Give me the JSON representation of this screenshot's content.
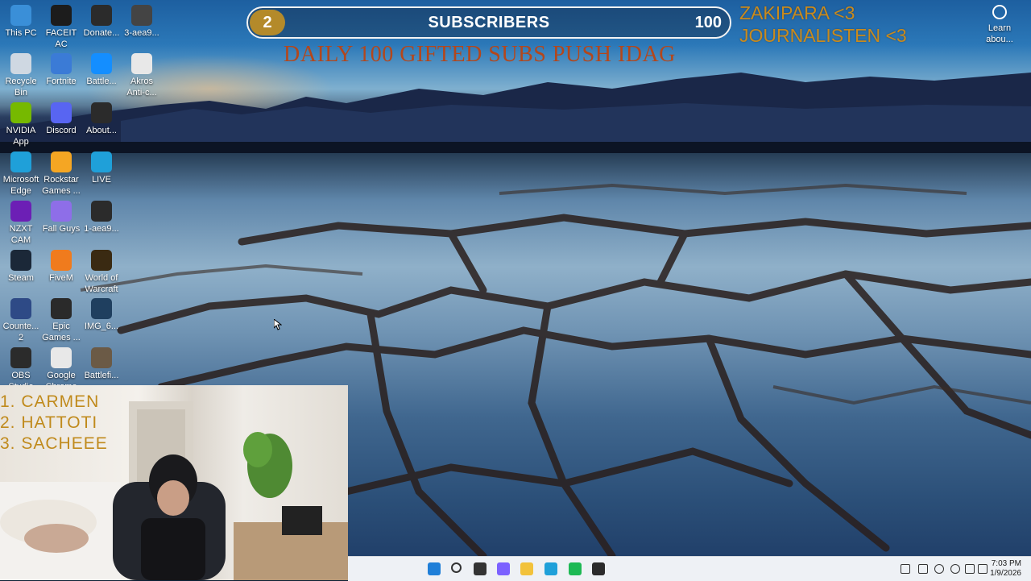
{
  "desktop_icons": [
    {
      "label": "This PC",
      "icon": "monitor-icon",
      "color": "#3a8fd8"
    },
    {
      "label": "FACEIT AC",
      "icon": "faceit-icon",
      "color": "#1c1c1c"
    },
    {
      "label": "Donate...",
      "icon": "donate-icon",
      "color": "#2b2b2b"
    },
    {
      "label": "3-aea9...",
      "icon": "image-file-icon",
      "color": "#444444"
    },
    {
      "label": "Recycle Bin",
      "icon": "recycle-bin-icon",
      "color": "#cfd8e2"
    },
    {
      "label": "Fortnite",
      "icon": "fortnite-icon",
      "color": "#3b7bd6"
    },
    {
      "label": "Battle...",
      "icon": "battlenet-icon",
      "color": "#148eff"
    },
    {
      "label": "Akros Anti-c...",
      "icon": "akros-icon",
      "color": "#e8e8e8"
    },
    {
      "label": "NVIDIA App",
      "icon": "nvidia-icon",
      "color": "#76b900"
    },
    {
      "label": "Discord",
      "icon": "discord-icon",
      "color": "#5865f2"
    },
    {
      "label": "About...",
      "icon": "about-file-icon",
      "color": "#2b2b2b"
    },
    {
      "label": "Microsoft Edge",
      "icon": "edge-icon",
      "color": "#1fa0d9"
    },
    {
      "label": "Rockstar Games ...",
      "icon": "rockstar-icon",
      "color": "#f5a623"
    },
    {
      "label": "LIVE",
      "icon": "live-icon",
      "color": "#1fa0d9"
    },
    {
      "label": "NZXT CAM",
      "icon": "nzxt-icon",
      "color": "#6c1fb5"
    },
    {
      "label": "Fall Guys",
      "icon": "fallguys-icon",
      "color": "#8e6ee8"
    },
    {
      "label": "1-aea9...",
      "icon": "image-file-icon",
      "color": "#2b2b2b"
    },
    {
      "label": "Steam",
      "icon": "steam-icon",
      "color": "#1b2838"
    },
    {
      "label": "FiveM",
      "icon": "fivem-icon",
      "color": "#f07b1d"
    },
    {
      "label": "World of Warcraft",
      "icon": "wow-icon",
      "color": "#3a2a12"
    },
    {
      "label": "Counte... 2",
      "icon": "cs2-icon",
      "color": "#2e4a86"
    },
    {
      "label": "Epic Games ...",
      "icon": "epic-games-icon",
      "color": "#2a2a2a"
    },
    {
      "label": "IMG_6...",
      "icon": "image-file-icon",
      "color": "#1f3f5f"
    },
    {
      "label": "OBS Studio",
      "icon": "obs-icon",
      "color": "#2b2b2b"
    },
    {
      "label": "Google Chrome",
      "icon": "chrome-icon",
      "color": "#e8e8e8"
    },
    {
      "label": "Battlefi...",
      "icon": "battlefield-icon",
      "color": "#6b5a46"
    }
  ],
  "overlay": {
    "sub_current": "2",
    "sub_label": "SUBSCRIBERS",
    "sub_goal": "100",
    "shoutout_1": "ZAKIPARA <3",
    "shoutout_2": "JOURNALISTEN <3",
    "daily_text": "DAILY 100  GIFTED SUBS PUSH IDAG"
  },
  "learn_about": {
    "label": "Learn abou...",
    "icon": "learn-about-icon"
  },
  "leaderboard": [
    "1.  CARMEN",
    "2.  HATTOTI",
    "3.  SACHEEE"
  ],
  "taskbar": {
    "buttons": [
      {
        "name": "start-button",
        "icon": "windows-start-icon",
        "color": "#1f7fd8"
      },
      {
        "name": "search-button",
        "icon": "search-icon",
        "color": "#333333"
      },
      {
        "name": "task-view-button",
        "icon": "task-view-icon",
        "color": "#333333"
      },
      {
        "name": "copilot-button",
        "icon": "copilot-icon",
        "color": "#7b61ff"
      },
      {
        "name": "file-explorer-button",
        "icon": "folder-icon",
        "color": "#f2c23b"
      },
      {
        "name": "edge-button",
        "icon": "edge-icon",
        "color": "#1fa0d9"
      },
      {
        "name": "spotify-button",
        "icon": "spotify-icon",
        "color": "#1db954"
      },
      {
        "name": "obs-button",
        "icon": "obs-icon",
        "color": "#2b2b2b"
      }
    ],
    "tray": [
      "chevron-up-icon",
      "network-off-icon",
      "mic-icon",
      "wifi-icon",
      "volume-icon",
      "battery-icon"
    ],
    "time": "7:03 PM",
    "date": "1/9/2026"
  }
}
